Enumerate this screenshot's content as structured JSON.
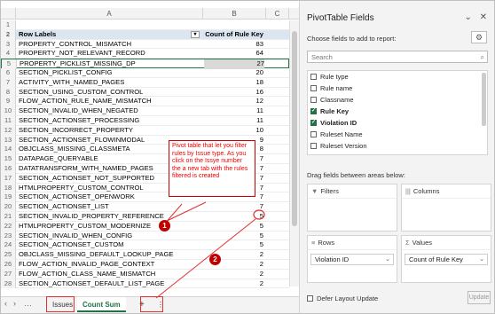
{
  "sheet": {
    "col_headers": [
      "A",
      "B",
      "C"
    ],
    "header": {
      "row_num": "2",
      "label": "Row Labels",
      "value": "Count of Rule Key"
    },
    "first_row_num": "1",
    "rows": [
      {
        "n": "3",
        "label": "PROPERTY_CONTROL_MISMATCH",
        "value": "83"
      },
      {
        "n": "4",
        "label": "PROPERTY_NOT_RELEVANT_RECORD",
        "value": "64"
      },
      {
        "n": "5",
        "label": "PROPERTY_PICKLIST_MISSING_DP",
        "value": "27"
      },
      {
        "n": "6",
        "label": "SECTION_PICKLIST_CONFIG",
        "value": "20"
      },
      {
        "n": "7",
        "label": "ACTIVITY_WITH_NAMED_PAGES",
        "value": "18"
      },
      {
        "n": "8",
        "label": "SECTION_USING_CUSTOM_CONTROL",
        "value": "16"
      },
      {
        "n": "9",
        "label": "FLOW_ACTION_RULE_NAME_MISMATCH",
        "value": "12"
      },
      {
        "n": "10",
        "label": "SECTION_INVALID_WHEN_NEGATED",
        "value": "11"
      },
      {
        "n": "11",
        "label": "SECTION_ACTIONSET_PROCESSING",
        "value": "11"
      },
      {
        "n": "12",
        "label": "SECTION_INCORRECT_PROPERTY",
        "value": "10"
      },
      {
        "n": "13",
        "label": "SECTION_ACTIONSET_FLOWINMODAL",
        "value": "9"
      },
      {
        "n": "14",
        "label": "OBJCLASS_MISSING_CLASSMETA",
        "value": "8"
      },
      {
        "n": "15",
        "label": "DATAPAGE_QUERYABLE",
        "value": "7"
      },
      {
        "n": "16",
        "label": "DATATRANSFORM_WITH_NAMED_PAGES",
        "value": "7"
      },
      {
        "n": "17",
        "label": "SECTION_ACTIONSET_NOT_SUPPORTED",
        "value": "7"
      },
      {
        "n": "18",
        "label": "HTMLPROPERTY_CUSTOM_CONTROL",
        "value": "7"
      },
      {
        "n": "19",
        "label": "SECTION_ACTIONSET_OPENWORK",
        "value": "7"
      },
      {
        "n": "20",
        "label": "SECTION_ACTIONSET_LIST",
        "value": "7"
      },
      {
        "n": "21",
        "label": "SECTION_INVALID_PROPERTY_REFERENCE",
        "value": "5"
      },
      {
        "n": "22",
        "label": "HTMLPROPERTY_CUSTOM_MODERNIZE",
        "value": "5"
      },
      {
        "n": "23",
        "label": "SECTION_INVALID_WHEN_CONFIG",
        "value": "5"
      },
      {
        "n": "24",
        "label": "SECTION_ACTIONSET_CUSTOM",
        "value": "5"
      },
      {
        "n": "25",
        "label": "OBJCLASS_MISSING_DEFAULT_LOOKUP_PAGE",
        "value": "2"
      },
      {
        "n": "26",
        "label": "FLOW_ACTION_INVALID_PAGE_CONTEXT",
        "value": "2"
      },
      {
        "n": "27",
        "label": "FLOW_ACTION_CLASS_NAME_MISMATCH",
        "value": "2"
      },
      {
        "n": "28",
        "label": "SECTION_ACTIONSET_DEFAULT_LIST_PAGE",
        "value": "2"
      }
    ],
    "tabs": [
      "Issues",
      "Count Sum"
    ],
    "active_tab": "Count Sum",
    "add_sheet": "+",
    "more": "⋮"
  },
  "callout": {
    "text": "Pivot table that let you filter rules by Issue type. As you click on the Issye number the a new tab with the rules filtered is created",
    "badge1": "1",
    "badge2": "2"
  },
  "pane": {
    "title": "PivotTable Fields",
    "subtitle": "Choose fields to add to report:",
    "search_placeholder": "Search",
    "fields": [
      {
        "label": "Rule type",
        "checked": false
      },
      {
        "label": "Rule name",
        "checked": false
      },
      {
        "label": "Classname",
        "checked": false
      },
      {
        "label": "Rule Key",
        "checked": true
      },
      {
        "label": "Violation ID",
        "checked": true
      },
      {
        "label": "Ruleset Name",
        "checked": false
      },
      {
        "label": "Ruleset Version",
        "checked": false
      }
    ],
    "drag_label": "Drag fields between areas below:",
    "zones": {
      "filters": "Filters",
      "columns": "Columns",
      "rows": "Rows",
      "values": "Values",
      "rows_chip": "Violation ID",
      "values_chip": "Count of Rule Key"
    },
    "defer_label": "Defer Layout Update",
    "update_label": "Update"
  },
  "colors": {
    "accent": "#217346",
    "annotation": "#e03030"
  }
}
